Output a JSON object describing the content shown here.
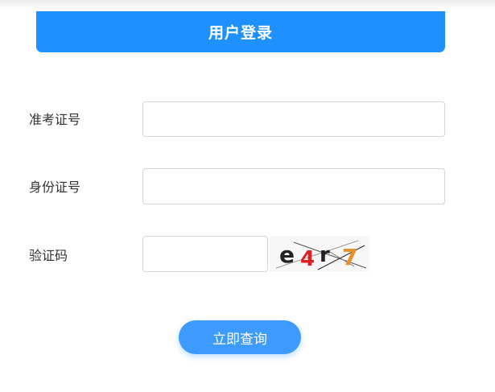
{
  "header": {
    "title": "用户登录",
    "color": "#1e90ff"
  },
  "form": {
    "exam_number": {
      "label": "准考证号",
      "value": "",
      "placeholder": ""
    },
    "id_number": {
      "label": "身份证号",
      "value": "",
      "placeholder": ""
    },
    "captcha": {
      "label": "验证码",
      "value": "",
      "placeholder": "",
      "image_text": "e4r7",
      "char_colors": [
        "#222222",
        "#e02020",
        "#222222",
        "#e8902a"
      ]
    }
  },
  "submit": {
    "label": "立即查询",
    "color": "#3d9bff"
  }
}
